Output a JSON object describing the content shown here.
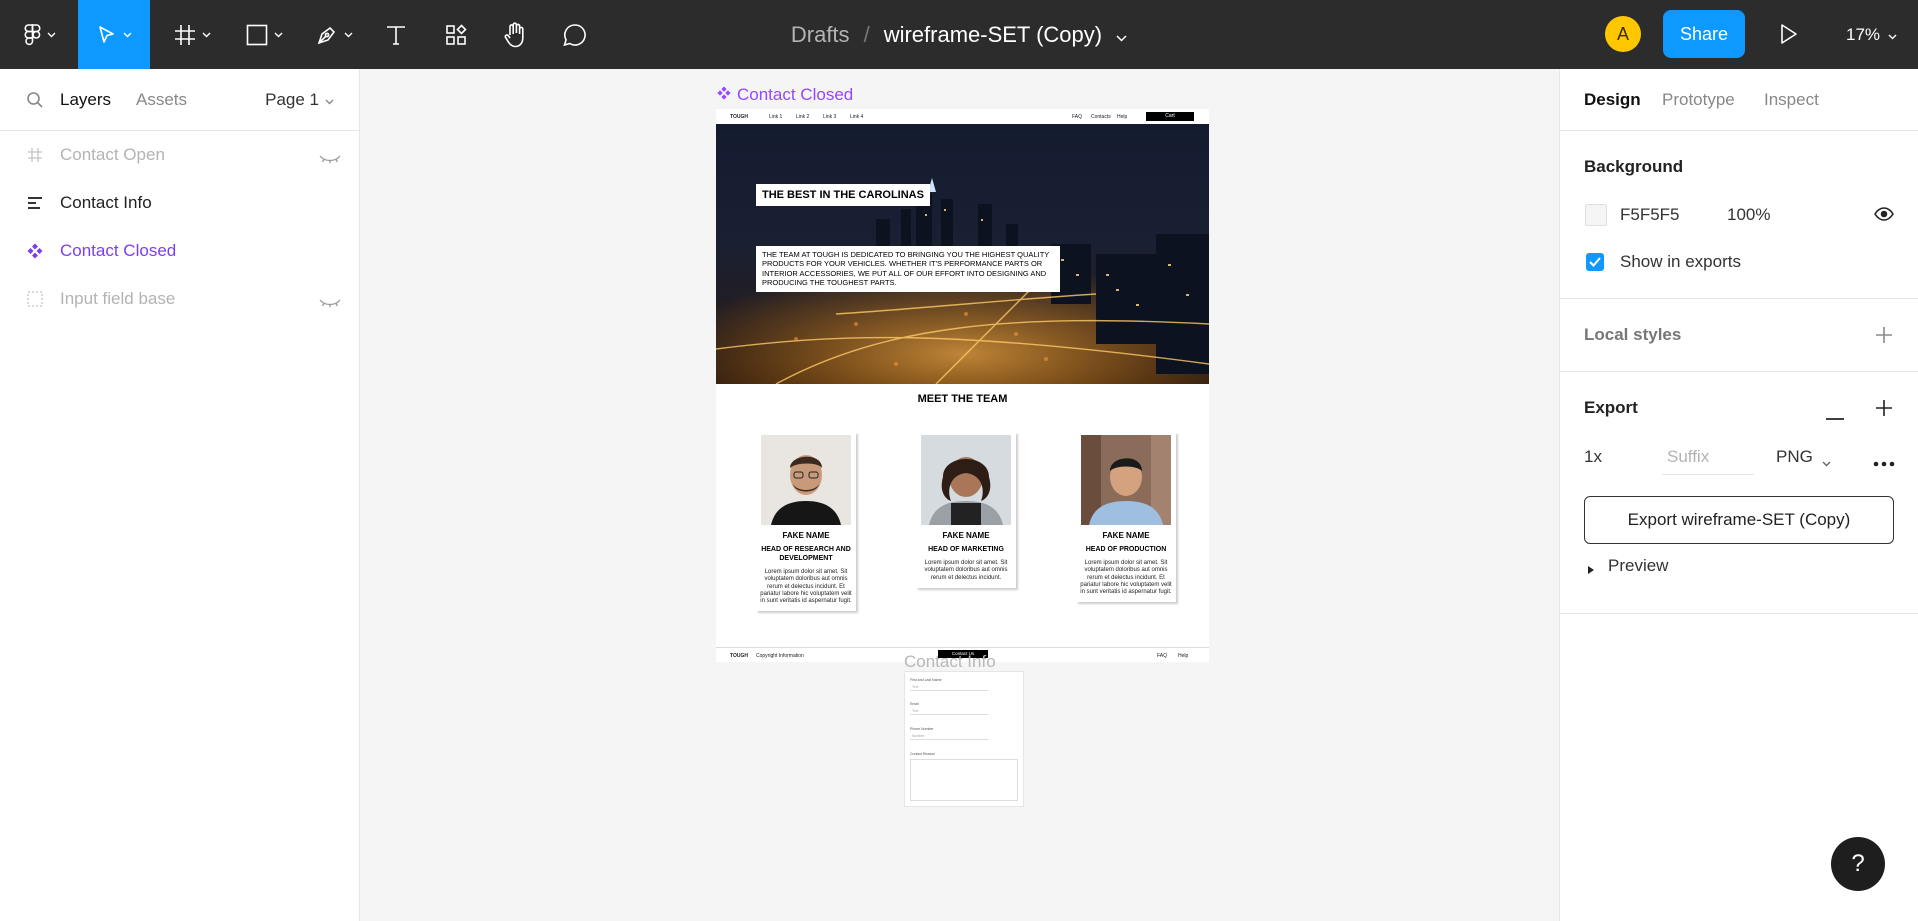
{
  "toolbar": {
    "breadcrumb_parent": "Drafts",
    "breadcrumb_separator": "/",
    "file_name": "wireframe-SET (Copy)",
    "avatar_initial": "A",
    "share_label": "Share",
    "zoom": "17%",
    "tools": [
      "main-menu",
      "move",
      "frame",
      "shape",
      "pen",
      "text",
      "resources",
      "hand",
      "comment"
    ],
    "colors": {
      "bar": "#2c2c2c",
      "accent": "#0d99ff",
      "avatar": "#ffc700"
    }
  },
  "left_panel": {
    "tabs": [
      {
        "label": "Layers"
      },
      {
        "label": "Assets"
      }
    ],
    "page_selector": "Page 1",
    "layers": [
      {
        "name": "Contact Open",
        "type": "frame",
        "hidden": true
      },
      {
        "name": "Contact Info",
        "type": "auto-layout",
        "hidden": false
      },
      {
        "name": "Contact Closed",
        "type": "component",
        "hidden": false
      },
      {
        "name": "Input field base",
        "type": "section",
        "hidden": true
      }
    ],
    "component_color": "#7b3ff2"
  },
  "canvas": {
    "frame_label": "Contact Closed",
    "second_frame_label": "Contact Info",
    "background": "#f5f5f5",
    "wireframe": {
      "nav": {
        "logo": "TOUGH",
        "links": [
          "Link 1",
          "Link 2",
          "Link 3",
          "Link 4"
        ],
        "right_links": [
          "FAQ",
          "Contacts",
          "Help"
        ],
        "cta": "Cart"
      },
      "hero_title": "THE BEST IN THE CAROLINAS",
      "hero_text": "THE TEAM AT TOUGH IS DEDICATED TO BRINGING YOU THE HIGHEST QUALITY PRODUCTS FOR YOUR VEHICLES. WHETHER IT'S PERFORMANCE PARTS OR INTERIOR ACCESSORIES, WE PUT ALL OF OUR EFFORT INTO DESIGNING AND PRODUCING THE TOUGHEST PARTS.",
      "team_heading": "MEET THE TEAM",
      "team": [
        {
          "name": "FAKE NAME",
          "role": "HEAD OF RESEARCH AND DEVELOPMENT",
          "desc": "Lorem ipsum dolor sit amet. Sit voluptatem doloribus aut omnis rerum et delectus incidunt. Et pariatur labore hic voluptatem velit in sunt veritatis id aspernatur fugit."
        },
        {
          "name": "FAKE NAME",
          "role": "HEAD OF MARKETING",
          "desc": "Lorem ipsum dolor sit amet. Sit voluptatem doloribus aut omnis rerum et delectus incidunt."
        },
        {
          "name": "FAKE NAME",
          "role": "HEAD OF PRODUCTION",
          "desc": "Lorem ipsum dolor sit amet. Sit voluptatem doloribus aut omnis rerum et delectus incidunt. Et pariatur labore hic voluptatem velit in sunt veritatis id aspernatur fugit."
        }
      ],
      "footer": {
        "logo": "TOUGH",
        "copyright": "Copyright Information",
        "cta": "Contact Us",
        "links": [
          "FAQ",
          "Help"
        ]
      }
    },
    "contact_form": {
      "fields": [
        {
          "label": "First and Last Name",
          "placeholder": "Text"
        },
        {
          "label": "Email",
          "placeholder": "Text"
        },
        {
          "label": "Phone Number",
          "placeholder": "Number"
        }
      ],
      "message_label": "Contact Reason"
    }
  },
  "right_panel": {
    "tabs": [
      {
        "label": "Design"
      },
      {
        "label": "Prototype"
      },
      {
        "label": "Inspect"
      }
    ],
    "background": {
      "heading": "Background",
      "hex": "F5F5F5",
      "opacity": "100%",
      "show_in_exports": "Show in exports",
      "show_in_exports_checked": true
    },
    "local_styles": {
      "heading": "Local styles"
    },
    "export": {
      "heading": "Export",
      "scale": "1x",
      "suffix_placeholder": "Suffix",
      "format": "PNG",
      "button": "Export wireframe-SET (Copy)",
      "preview": "Preview"
    }
  },
  "help_label": "?"
}
